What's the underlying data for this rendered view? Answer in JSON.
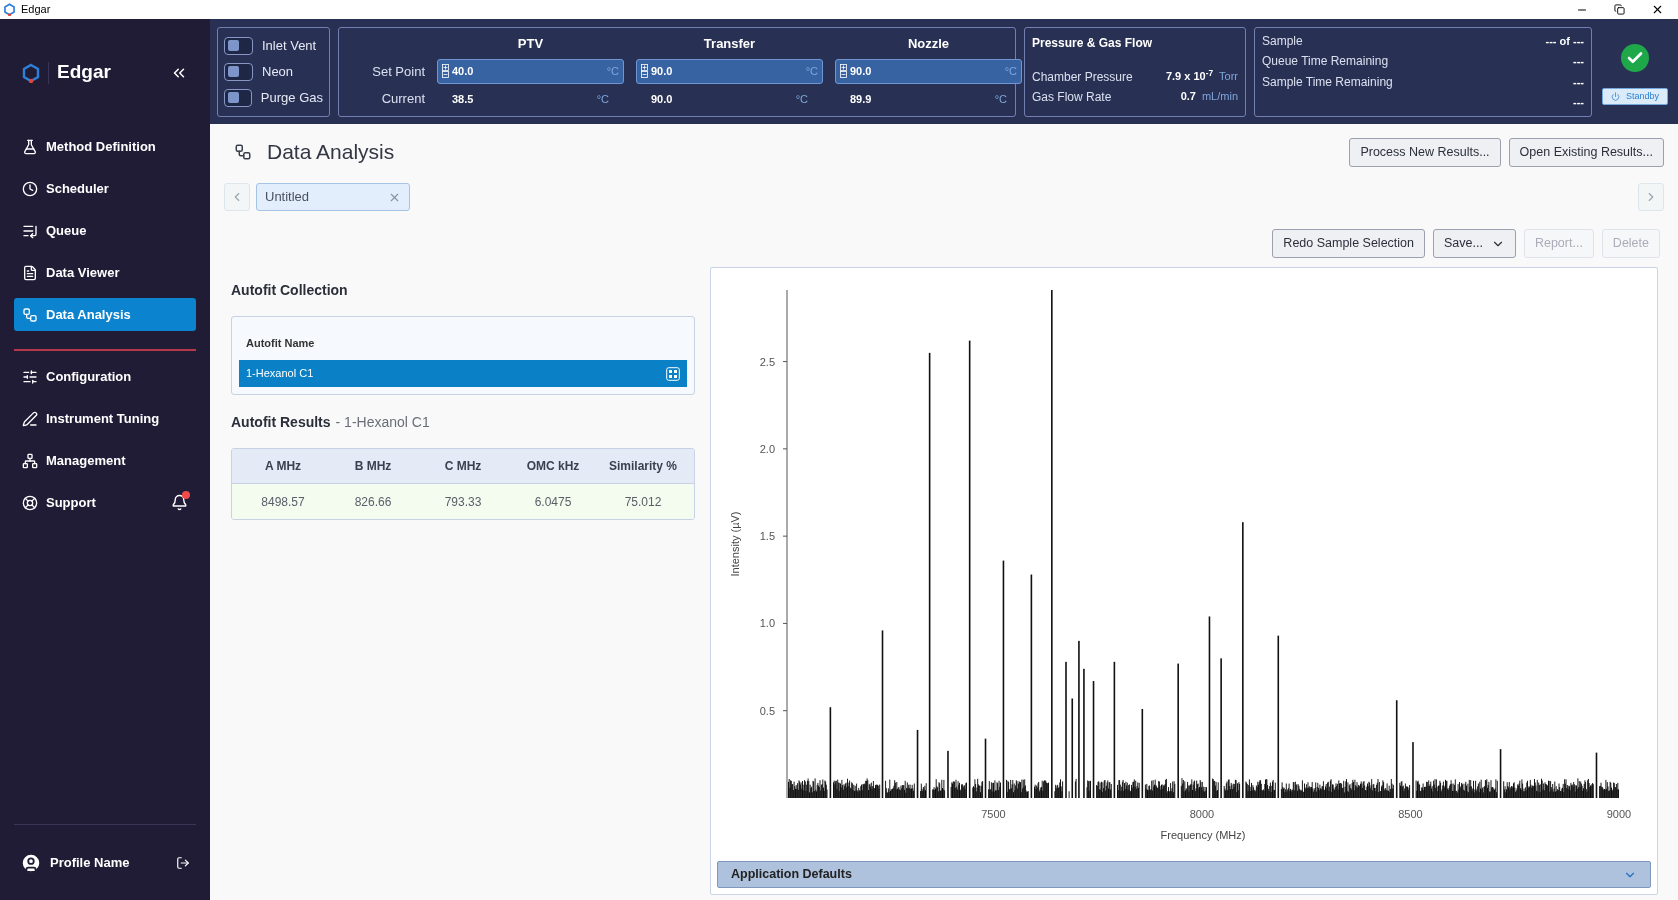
{
  "window": {
    "title": "Edgar"
  },
  "sidebar": {
    "brand": "Edgar",
    "items": [
      {
        "label": "Method Definition",
        "selected": false
      },
      {
        "label": "Scheduler",
        "selected": false
      },
      {
        "label": "Queue",
        "selected": false
      },
      {
        "label": "Data Viewer",
        "selected": false
      },
      {
        "label": "Data Analysis",
        "selected": true
      },
      {
        "label": "Configuration",
        "selected": false,
        "group_start": true
      },
      {
        "label": "Instrument Tuning",
        "selected": false
      },
      {
        "label": "Management",
        "selected": false
      },
      {
        "label": "Support",
        "selected": false,
        "notification": true
      }
    ],
    "profile": {
      "name": "Profile Name"
    }
  },
  "header": {
    "toggles": [
      {
        "label": "Inlet Vent",
        "on": false
      },
      {
        "label": "Neon",
        "on": false
      },
      {
        "label": "Purge Gas",
        "on": false
      }
    ],
    "temperatures": {
      "setpoint_label": "Set Point",
      "current_label": "Current",
      "zones": [
        {
          "name": "PTV",
          "setpoint": "40.0",
          "setpoint_unit": "°C",
          "current": "38.5",
          "current_unit": "°C"
        },
        {
          "name": "Transfer",
          "setpoint": "90.0",
          "setpoint_unit": "°C",
          "current": "90.0",
          "current_unit": "°C"
        },
        {
          "name": "Nozzle",
          "setpoint": "90.0",
          "setpoint_unit": "°C",
          "current": "89.9",
          "current_unit": "°C"
        }
      ]
    },
    "pressure": {
      "title": "Pressure & Gas Flow",
      "rows": [
        {
          "label": "Chamber Pressure",
          "value": "7.9 x 10$^{-7}$",
          "unit": "Torr"
        },
        {
          "label": "Gas Flow Rate",
          "value": "0.7",
          "unit": "mL/min"
        }
      ]
    },
    "sample": {
      "rows": [
        {
          "label": "Sample",
          "value": "--- of ---"
        },
        {
          "label": "Queue Time Remaining",
          "value": "---"
        },
        {
          "label": "Sample Time Remaining",
          "value": "---"
        },
        {
          "value": "---"
        }
      ]
    },
    "status": {
      "ok": true,
      "button": "Standby"
    }
  },
  "page": {
    "title": "Data Analysis",
    "buttons": [
      "Process New Results...",
      "Open Existing Results..."
    ],
    "tabs": [
      {
        "label": "Untitled",
        "selected": true
      }
    ],
    "actions": [
      {
        "label": "Redo Sample Selection",
        "disabled": false,
        "kind": "button"
      },
      {
        "label": "Save...",
        "disabled": false,
        "kind": "dropdown"
      },
      {
        "label": "Report...",
        "disabled": true,
        "kind": "button"
      },
      {
        "label": "Delete",
        "disabled": true,
        "kind": "button"
      }
    ]
  },
  "autofit_collection": {
    "title": "Autofit Collection",
    "column": "Autofit Name",
    "rows": [
      {
        "name": "1-Hexanol C1",
        "selected": true
      }
    ]
  },
  "autofit_results": {
    "title": "Autofit Results",
    "subtitle": "- 1-Hexanol C1",
    "columns": [
      "A MHz",
      "B MHz",
      "C MHz",
      "OMC kHz",
      "Similarity %"
    ],
    "rows": [
      [
        "8498.57",
        "826.66",
        "793.33",
        "6.0475",
        "75.012"
      ]
    ]
  },
  "spectrum": {
    "chart_data": {
      "type": "bar",
      "xlabel": "Frequency (MHz)",
      "ylabel": "Intensity (µV)",
      "xlim": [
        7005,
        9000
      ],
      "ylim": [
        0,
        2.91
      ],
      "xticks": [
        7500,
        8000,
        8500,
        9000
      ],
      "yticks": [
        0.5,
        {
          "value": 1,
          "label": "1.0"
        },
        1.5,
        {
          "value": 2,
          "label": "2.0"
        },
        2.5
      ],
      "x": [
        7109,
        7234,
        7318,
        7347,
        7391,
        7443,
        7481,
        7524,
        7591,
        7640,
        7674,
        7689,
        7705,
        7717,
        7740,
        7790,
        7857,
        7943,
        8018,
        8046,
        8098,
        8183,
        8467,
        8506,
        8716,
        8946
      ],
      "values": [
        0.52,
        0.96,
        0.39,
        2.55,
        0.27,
        2.62,
        0.34,
        1.36,
        1.28,
        2.91,
        0.78,
        0.57,
        0.9,
        0.74,
        0.67,
        0.78,
        0.51,
        0.77,
        1.04,
        0.8,
        1.58,
        0.93,
        0.56,
        0.32,
        0.28,
        0.26
      ]
    }
  },
  "accordion": {
    "label": "Application Defaults",
    "expanded": false
  }
}
